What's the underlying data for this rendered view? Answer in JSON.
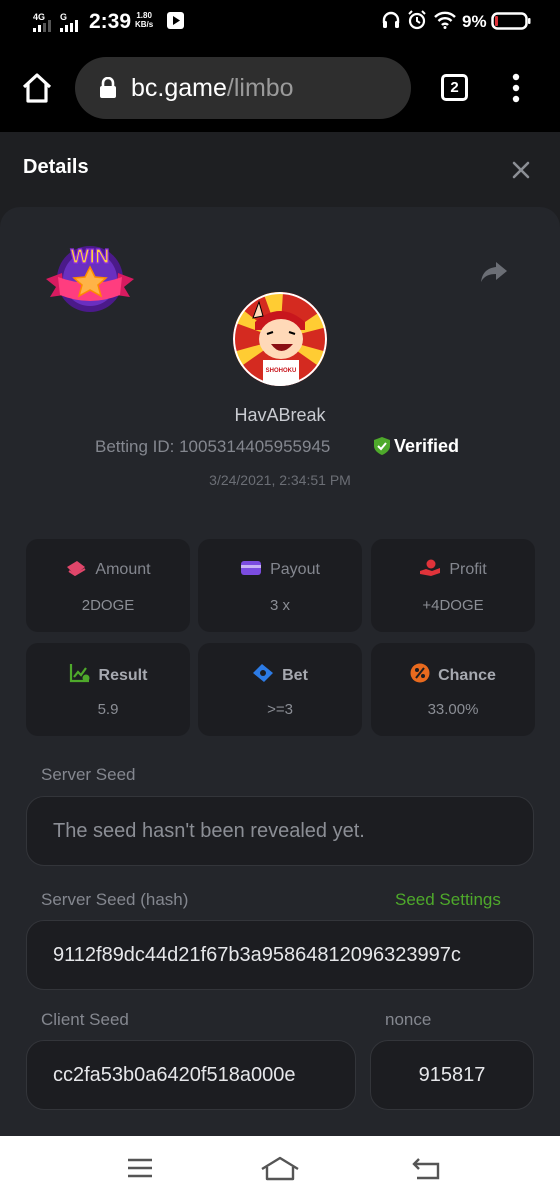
{
  "status_bar": {
    "sim1_network": "4G",
    "sim2_network": "G",
    "time": "2:39",
    "speed_value": "1.80",
    "speed_unit": "KB/s",
    "battery": "9%"
  },
  "browser": {
    "url_domain": "bc.game",
    "url_path": "/limbo",
    "tab_count": "2"
  },
  "details": {
    "title": "Details",
    "username": "HavABreak",
    "betting_id": "Betting ID: 1005314405955945",
    "verified_label": "Verified",
    "timestamp": "3/24/2021, 2:34:51 PM",
    "stats": [
      {
        "label": "Amount",
        "value": "2DOGE",
        "icon": "coins-icon",
        "color": "#e0466a"
      },
      {
        "label": "Payout",
        "value": "3 x",
        "icon": "wallet-icon",
        "color": "#7b4ce0"
      },
      {
        "label": "Profit",
        "value": "+4DOGE",
        "icon": "hand-coin-icon",
        "color": "#e0333a"
      },
      {
        "label": "Result",
        "value": "5.9",
        "icon": "chart-icon",
        "color": "#4ea92b"
      },
      {
        "label": "Bet",
        "value": ">=3",
        "icon": "ticket-icon",
        "color": "#2c7be5"
      },
      {
        "label": "Chance",
        "value": "33.00%",
        "icon": "percent-icon",
        "color": "#e86a1e"
      }
    ],
    "server_seed_label": "Server Seed",
    "server_seed_value": "The seed hasn't been revealed yet.",
    "server_seed_hash_label": "Server Seed (hash)",
    "seed_settings_label": "Seed Settings",
    "server_seed_hash_value": "9112f89dc44d21f67b3a95864812096323997c",
    "client_seed_label": "Client Seed",
    "client_seed_value": "cc2fa53b0a6420f518a000e",
    "nonce_label": "nonce",
    "nonce_value": "915817"
  },
  "badge": {
    "text": "WIN"
  },
  "avatar": {
    "jersey_text": "SHOHOKU"
  },
  "colors": {
    "page_bg": "#1e1f22",
    "card_bg": "#24262b",
    "tile_bg": "#1c1d21",
    "accent_green": "#4ea92b"
  }
}
